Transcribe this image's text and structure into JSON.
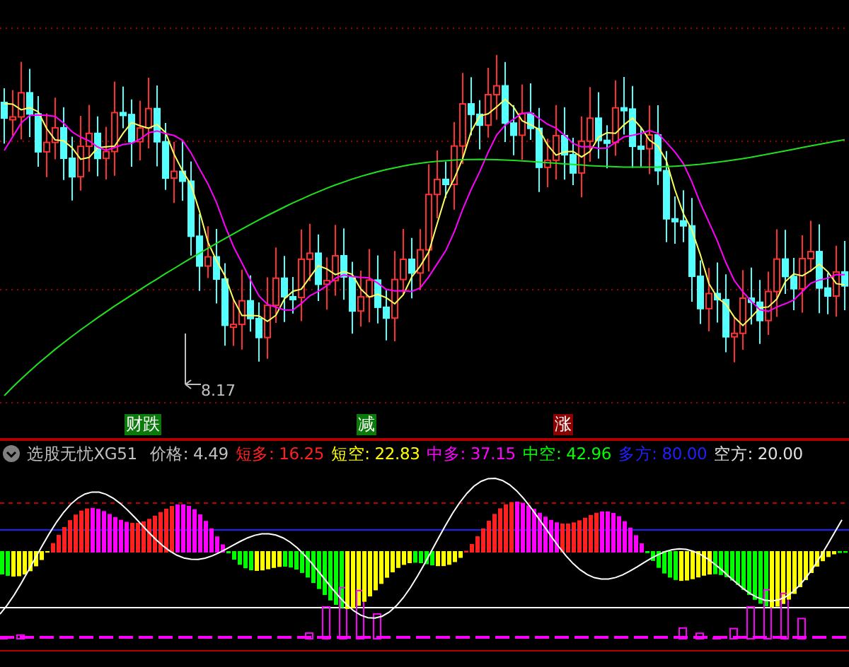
{
  "main_chart": {
    "low_label": "8.17"
  },
  "signals": [
    {
      "label": "财跌",
      "color": "#0a7a0a"
    },
    {
      "label": "减",
      "color": "#0a7a0a"
    },
    {
      "label": "涨",
      "color": "#8b0000"
    }
  ],
  "indicator": {
    "name": "选股无忧XG51",
    "readings": [
      {
        "label": "价格:",
        "value": "4.49",
        "color": "#c0c0c0"
      },
      {
        "label": "短多:",
        "value": "16.25",
        "color": "#ff2020"
      },
      {
        "label": "短空:",
        "value": "22.83",
        "color": "#ffff00"
      },
      {
        "label": "中多:",
        "value": "37.15",
        "color": "#ff00ff"
      },
      {
        "label": "中空:",
        "value": "42.96",
        "color": "#00ff00"
      },
      {
        "label": "多方:",
        "value": "80.00",
        "color": "#2020ff"
      },
      {
        "label": "空方:",
        "value": "20.00",
        "color": "#e0e0e0"
      }
    ]
  }
}
